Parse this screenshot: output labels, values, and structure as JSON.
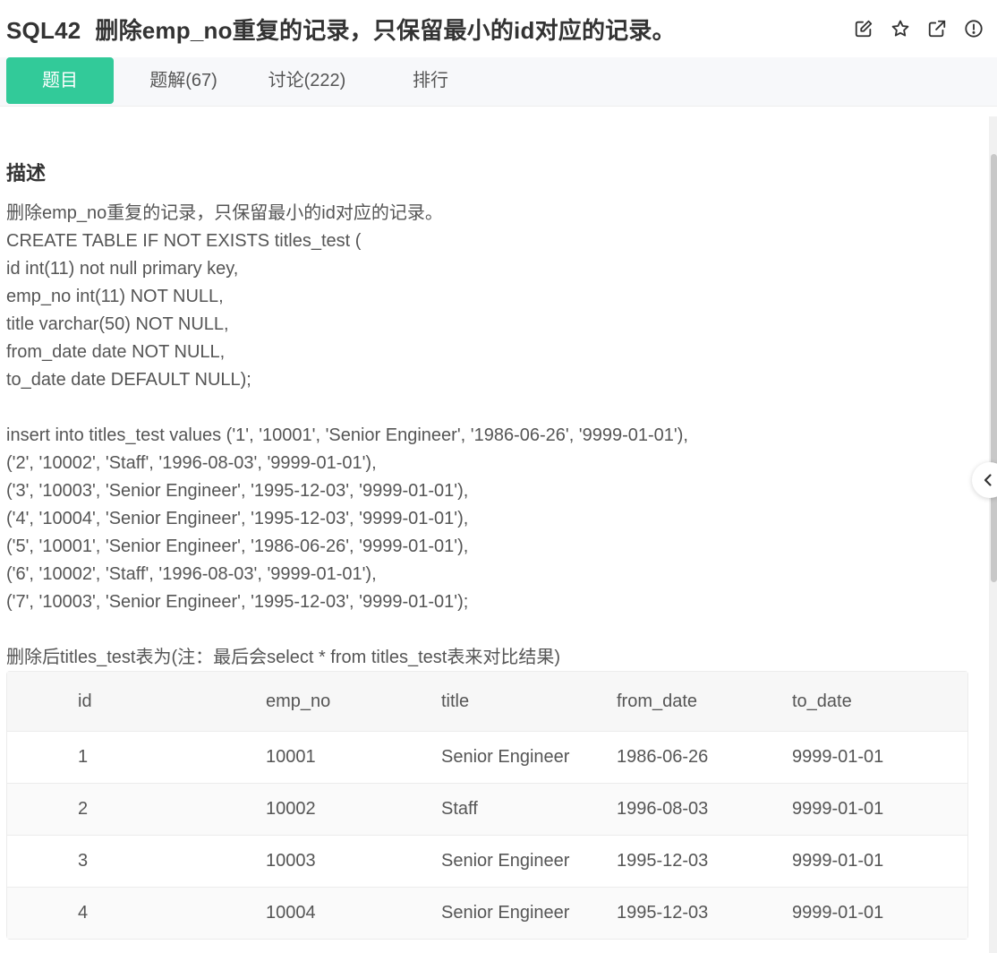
{
  "header": {
    "problem_code": "SQL42",
    "problem_title": "删除emp_no重复的记录，只保留最小的id对应的记录。"
  },
  "tabs": [
    {
      "label": "题目",
      "active": true
    },
    {
      "label": "题解(67)",
      "active": false
    },
    {
      "label": "讨论(222)",
      "active": false
    },
    {
      "label": "排行",
      "active": false
    }
  ],
  "content": {
    "section_title": "描述",
    "lines": [
      "删除emp_no重复的记录，只保留最小的id对应的记录。",
      "CREATE TABLE IF NOT EXISTS titles_test (",
      "id int(11) not null primary key,",
      "emp_no int(11) NOT NULL,",
      "title varchar(50) NOT NULL,",
      "from_date date NOT NULL,",
      "to_date date DEFAULT NULL);",
      "",
      "insert into titles_test values ('1', '10001', 'Senior Engineer', '1986-06-26', '9999-01-01'),",
      "('2', '10002', 'Staff', '1996-08-03', '9999-01-01'),",
      "('3', '10003', 'Senior Engineer', '1995-12-03', '9999-01-01'),",
      "('4', '10004', 'Senior Engineer', '1995-12-03', '9999-01-01'),",
      "('5', '10001', 'Senior Engineer', '1986-06-26', '9999-01-01'),",
      "('6', '10002', 'Staff', '1996-08-03', '9999-01-01'),",
      "('7', '10003', 'Senior Engineer', '1995-12-03', '9999-01-01');",
      "",
      "删除后titles_test表为(注：最后会select * from titles_test表来对比结果)"
    ]
  },
  "table": {
    "columns": [
      "id",
      "emp_no",
      "title",
      "from_date",
      "to_date"
    ],
    "rows": [
      [
        "1",
        "10001",
        "Senior Engineer",
        "1986-06-26",
        "9999-01-01"
      ],
      [
        "2",
        "10002",
        "Staff",
        "1996-08-03",
        "9999-01-01"
      ],
      [
        "3",
        "10003",
        "Senior Engineer",
        "1995-12-03",
        "9999-01-01"
      ],
      [
        "4",
        "10004",
        "Senior Engineer",
        "1995-12-03",
        "9999-01-01"
      ]
    ]
  },
  "icons": {
    "edit": "edit-icon",
    "favorite": "star-icon",
    "open": "external-link-icon",
    "report": "info-icon",
    "collapse": "chevron-left-icon"
  },
  "colors": {
    "accent": "#32ca99",
    "text": "#333333",
    "muted": "#555555"
  }
}
